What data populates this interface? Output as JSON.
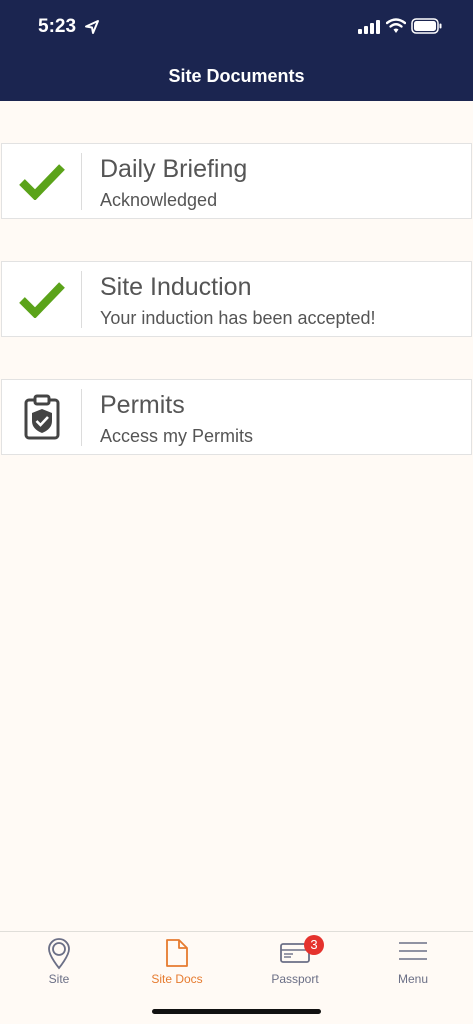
{
  "status_bar": {
    "time": "5:23"
  },
  "header": {
    "title": "Site Documents"
  },
  "documents": [
    {
      "title": "Daily Briefing",
      "subtitle": "Acknowledged",
      "icon": "check-icon",
      "status": "complete"
    },
    {
      "title": "Site Induction",
      "subtitle": "Your induction has been accepted!",
      "icon": "check-icon",
      "status": "complete"
    },
    {
      "title": "Permits",
      "subtitle": "Access my Permits",
      "icon": "clipboard-check-icon",
      "status": "link"
    }
  ],
  "tabbar": {
    "tabs": [
      {
        "label": "Site",
        "icon": "location-pin-icon"
      },
      {
        "label": "Site Docs",
        "icon": "document-icon",
        "active": true
      },
      {
        "label": "Passport",
        "icon": "id-card-icon",
        "badge": "3"
      },
      {
        "label": "Menu",
        "icon": "hamburger-menu-icon"
      }
    ]
  },
  "colors": {
    "header_bg": "#1b2550",
    "page_bg": "#fffaf5",
    "check_green": "#5ba31a",
    "active_tab": "#e67b2f",
    "badge_red": "#e5322d"
  }
}
